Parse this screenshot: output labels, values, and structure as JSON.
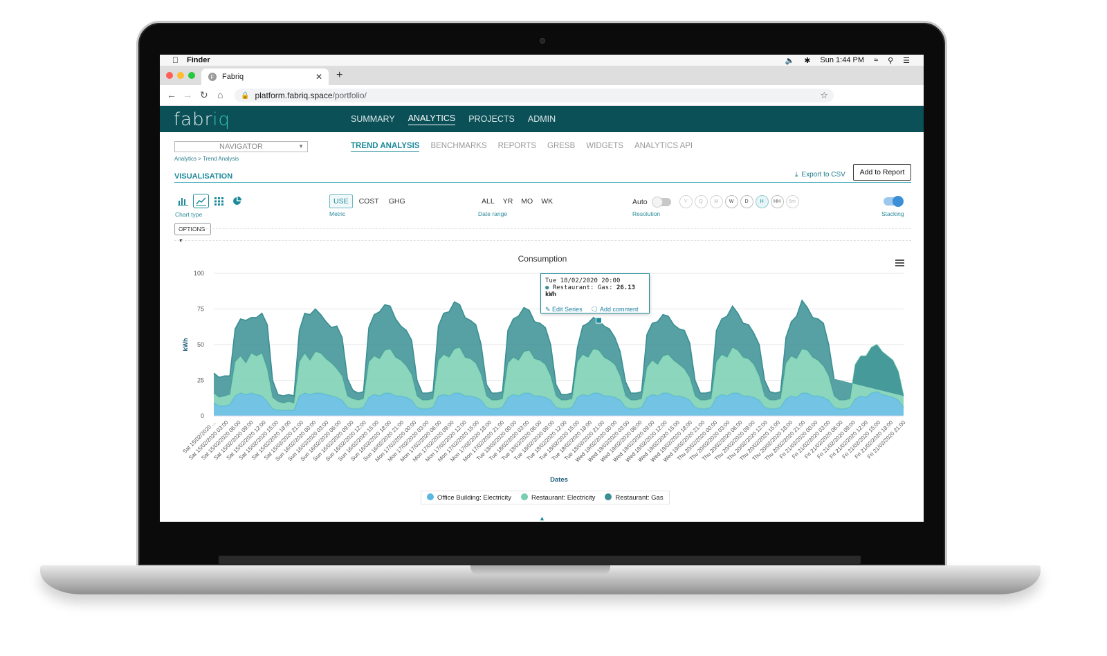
{
  "menubar": {
    "app": "Finder",
    "clock": "Sun 1:44 PM"
  },
  "browser": {
    "tab_title": "Fabriq",
    "favicon_letter": "F",
    "url_host": "platform.fabriq.space",
    "url_path": "/portfolio/"
  },
  "app": {
    "logo_prefix": "fabr",
    "logo_accent": "iq",
    "main_nav": [
      "SUMMARY",
      "ANALYTICS",
      "PROJECTS",
      "ADMIN"
    ],
    "main_nav_active": "ANALYTICS",
    "navigator_label": "NAVIGATOR",
    "breadcrumb": "Analytics > Trend Analysis",
    "sub_nav": [
      "TREND ANALYSIS",
      "BENCHMARKS",
      "REPORTS",
      "GRESB",
      "WIDGETS",
      "ANALYTICS API"
    ],
    "sub_nav_active": "TREND ANALYSIS",
    "section_title": "VISUALISATION",
    "export_label": "Export to CSV",
    "add_report_label": "Add to Report",
    "options_label": "OPTIONS"
  },
  "controls": {
    "chart_type_label": "Chart type",
    "metric_label": "Metric",
    "metrics": [
      "USE",
      "COST",
      "GHG"
    ],
    "metric_selected": "USE",
    "date_range_label": "Date range",
    "date_ranges": [
      "ALL",
      "YR",
      "MO",
      "WK"
    ],
    "resolution_label": "Resolution",
    "auto_label": "Auto",
    "resolutions": [
      "Y",
      "Q",
      "M",
      "W",
      "D",
      "H",
      "HH",
      "5m"
    ],
    "resolution_selected": "H",
    "stacking_label": "Stacking",
    "stacking_on": true
  },
  "chart_data": {
    "type": "area",
    "title": "Consumption",
    "xlabel": "Dates",
    "ylabel": "kWh",
    "ylim": [
      0,
      100
    ],
    "y_ticks": [
      0,
      25,
      50,
      75,
      100
    ],
    "stacked": true,
    "x_labels": [
      "Sat 15/02/2020 ...",
      "Sat 15/02/2020 03:00",
      "Sat 15/02/2020 06:00",
      "Sat 15/02/2020 09:00",
      "Sat 15/02/2020 12:00",
      "Sat 15/02/2020 15:00",
      "Sat 15/02/2020 18:00",
      "Sat 15/02/2020 21:00",
      "Sun 16/02/2020 00:00",
      "Sun 16/02/2020 03:00",
      "Sun 16/02/2020 06:00",
      "Sun 16/02/2020 09:00",
      "Sun 16/02/2020 12:00",
      "Sun 16/02/2020 15:00",
      "Sun 16/02/2020 18:00",
      "Sun 16/02/2020 21:00",
      "Mon 17/02/2020 00:00",
      "Mon 17/02/2020 03:00",
      "Mon 17/02/2020 06:00",
      "Mon 17/02/2020 09:00",
      "Mon 17/02/2020 12:00",
      "Mon 17/02/2020 15:00",
      "Mon 17/02/2020 18:00",
      "Mon 17/02/2020 21:00",
      "Tue 18/02/2020 00:00",
      "Tue 18/02/2020 03:00",
      "Tue 18/02/2020 06:00",
      "Tue 18/02/2020 09:00",
      "Tue 18/02/2020 12:00",
      "Tue 18/02/2020 15:00",
      "Tue 18/02/2020 18:00",
      "Tue 18/02/2020 21:00",
      "Wed 19/02/2020 00:00",
      "Wed 19/02/2020 03:00",
      "Wed 19/02/2020 06:00",
      "Wed 19/02/2020 09:00",
      "Wed 19/02/2020 12:00",
      "Wed 19/02/2020 15:00",
      "Wed 19/02/2020 18:00",
      "Wed 19/02/2020 21:00",
      "Thu 20/02/2020 00:00",
      "Thu 20/02/2020 03:00",
      "Thu 20/02/2020 06:00",
      "Thu 20/02/2020 09:00",
      "Thu 20/02/2020 12:00",
      "Thu 20/02/2020 15:00",
      "Thu 20/02/2020 18:00",
      "Thu 20/02/2020 21:00",
      "Fri 21/02/2020 00:00",
      "Fri 21/02/2020 03:00",
      "Fri 21/02/2020 06:00",
      "Fri 21/02/2020 09:00",
      "Fri 21/02/2020 12:00",
      "Fri 21/02/2020 15:00",
      "Fri 21/02/2020 18:00",
      "Fri 21/02/2020 21:00"
    ],
    "series": [
      {
        "name": "Office Building: Electricity",
        "color": "#5bb8e0",
        "values": [
          9,
          7,
          7,
          8,
          14,
          16,
          15,
          16,
          15,
          14,
          10,
          5,
          4,
          4,
          4,
          4,
          14,
          16,
          15,
          16,
          16,
          15,
          14,
          13,
          11,
          6,
          5,
          5,
          6,
          13,
          15,
          14,
          16,
          16,
          14,
          14,
          13,
          11,
          6,
          5,
          5,
          6,
          14,
          15,
          14,
          16,
          16,
          14,
          14,
          13,
          11,
          6,
          5,
          5,
          6,
          13,
          15,
          14,
          16,
          16,
          14,
          14,
          13,
          11,
          6,
          5,
          5,
          6,
          13,
          15,
          14,
          16,
          16,
          14,
          14,
          13,
          11,
          6,
          5,
          5,
          6,
          13,
          15,
          14,
          16,
          16,
          14,
          14,
          13,
          11,
          6,
          5,
          5,
          6,
          13,
          15,
          14,
          16,
          16,
          14,
          14,
          13,
          11,
          6,
          5,
          5,
          6,
          12,
          14,
          13,
          16,
          16,
          14,
          14,
          13,
          11,
          6,
          5,
          5,
          6,
          12,
          14,
          13,
          16,
          17,
          15,
          14,
          13,
          11,
          6
        ]
      },
      {
        "name": "Restaurant: Electricity",
        "color": "#77cfb0",
        "values": [
          7,
          6,
          7,
          7,
          24,
          26,
          22,
          28,
          27,
          30,
          23,
          8,
          6,
          5,
          6,
          5,
          24,
          28,
          24,
          29,
          28,
          25,
          23,
          20,
          17,
          8,
          7,
          6,
          6,
          25,
          27,
          26,
          30,
          31,
          27,
          25,
          22,
          18,
          8,
          6,
          6,
          6,
          25,
          28,
          27,
          31,
          32,
          27,
          26,
          24,
          18,
          8,
          6,
          6,
          6,
          24,
          26,
          25,
          29,
          30,
          26,
          25,
          23,
          17,
          8,
          6,
          6,
          6,
          25,
          28,
          27,
          31,
          30,
          27,
          25,
          23,
          17,
          8,
          6,
          6,
          6,
          21,
          24,
          22,
          26,
          27,
          25,
          22,
          20,
          16,
          8,
          6,
          6,
          6,
          25,
          28,
          27,
          32,
          30,
          27,
          26,
          23,
          17,
          8,
          6,
          6,
          6,
          25,
          28,
          27,
          31,
          30,
          27,
          25,
          22,
          17,
          8,
          6,
          6,
          6,
          24,
          28,
          29,
          32,
          33,
          30,
          28,
          26,
          20,
          8
        ]
      },
      {
        "name": "Restaurant: Gas",
        "color": "#3a8f93",
        "values": [
          14,
          14,
          14,
          13,
          23,
          26,
          30,
          25,
          27,
          28,
          31,
          12,
          5,
          5,
          5,
          5,
          22,
          28,
          32,
          30,
          27,
          26,
          25,
          30,
          27,
          12,
          6,
          5,
          5,
          24,
          29,
          33,
          32,
          30,
          27,
          24,
          25,
          24,
          11,
          5,
          5,
          5,
          24,
          29,
          32,
          33,
          30,
          28,
          27,
          27,
          21,
          8,
          5,
          5,
          5,
          23,
          27,
          31,
          31,
          28,
          26,
          26,
          26,
          22,
          8,
          4,
          4,
          4,
          10,
          20,
          24,
          22,
          21,
          22,
          22,
          19,
          17,
          10,
          5,
          5,
          5,
          23,
          26,
          30,
          29,
          27,
          25,
          25,
          27,
          24,
          11,
          5,
          5,
          5,
          22,
          25,
          29,
          29,
          26,
          24,
          24,
          22,
          22,
          11,
          6,
          5,
          5,
          18,
          24,
          30,
          34,
          30,
          28,
          29,
          30,
          22,
          12
        ]
      }
    ],
    "tooltip": {
      "date": "Tue 18/02/2020 20:00",
      "series": "Restaurant: Gas",
      "value": "26.13 kWh",
      "edit_label": "Edit Series",
      "comment_label": "Add comment"
    }
  }
}
